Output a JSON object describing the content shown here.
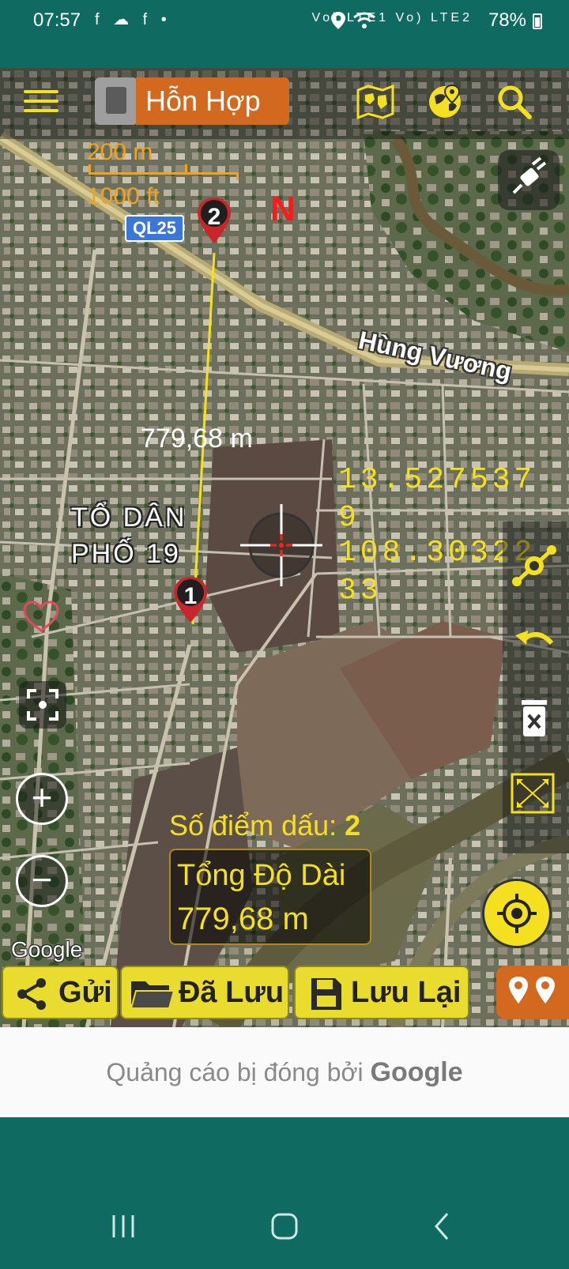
{
  "status_bar": {
    "time": "07:57",
    "notification_icons": "f ☁ f •",
    "network_text": "Vo) LTE1 Vo) LTE2",
    "battery": "78%"
  },
  "toolbar": {
    "map_type": "Hỗn Hợp",
    "icons": [
      "menu-icon",
      "layers-icon",
      "world-map-icon",
      "globe-pin-icon",
      "search-icon"
    ]
  },
  "map": {
    "scale_metric": "200 m",
    "scale_imperial": "1000 ft",
    "north_label": "N",
    "road_badge": "QL25",
    "street_name": "Hùng Vương",
    "segment_distance": "779,68 m",
    "area_label_line1": "TỔ DÂN",
    "area_label_line2": "PHỐ 19",
    "coordinates": {
      "lat_line1": "13.527537",
      "lat_line2": "9",
      "lon_line1": "108.30322",
      "lon_line2": "33"
    },
    "marker_1_label": "1",
    "marker_2_label": "2",
    "google_attribution": "Google"
  },
  "measurement": {
    "points_label": "Số điểm dấu:",
    "points_count": "2",
    "total_label": "Tổng Độ Dài",
    "total_value": "779,68 m"
  },
  "bottom_buttons": {
    "send": "Gửi",
    "saved": "Đã Lưu",
    "save": "Lưu Lại"
  },
  "ad": {
    "text": "Quảng cáo bị đóng bởi",
    "brand": "Google"
  },
  "colors": {
    "accent_yellow": "#f5e020",
    "orange": "#d2691e",
    "teal": "#0f6b61"
  }
}
